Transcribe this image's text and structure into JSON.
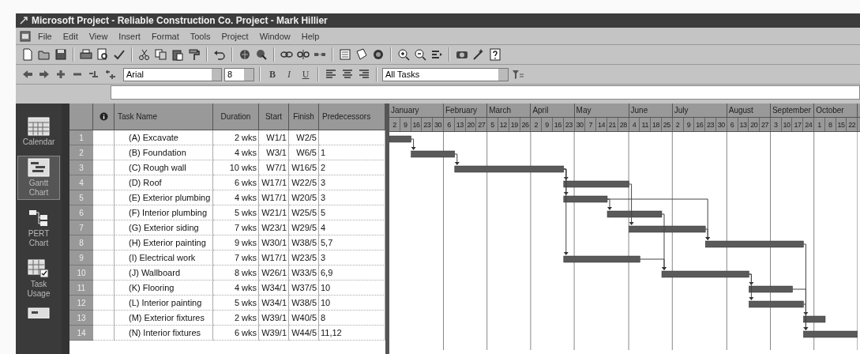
{
  "window": {
    "title": "Microsoft Project - Reliable Construction Co. Project - Mark Hillier"
  },
  "menu": [
    "File",
    "Edit",
    "View",
    "Insert",
    "Format",
    "Tools",
    "Project",
    "Window",
    "Help"
  ],
  "format_toolbar": {
    "font": "Arial",
    "font_size": "8",
    "style_buttons": [
      "B",
      "I",
      "U"
    ],
    "filter": "All Tasks"
  },
  "view_bar": [
    {
      "label": "Calendar",
      "selected": false,
      "kind": "calendar"
    },
    {
      "label": "Gantt Chart",
      "selected": true,
      "kind": "gantt"
    },
    {
      "label": "PERT Chart",
      "selected": false,
      "kind": "pert"
    },
    {
      "label": "Task Usage",
      "selected": false,
      "kind": "usage"
    }
  ],
  "table": {
    "columns": [
      "Task Name",
      "Duration",
      "Start",
      "Finish",
      "Predecessors"
    ],
    "rows": [
      {
        "id": "1",
        "name": "(A) Excavate",
        "duration": "2 wks",
        "start": "W1/1",
        "finish": "W2/5"
      },
      {
        "id": "2",
        "name": "(B) Foundation",
        "duration": "4 wks",
        "start": "W3/1",
        "finish": "W6/5",
        "predecessors": "1"
      },
      {
        "id": "3",
        "name": "(C) Rough wall",
        "duration": "10 wks",
        "start": "W7/1",
        "finish": "W16/5",
        "predecessors": "2"
      },
      {
        "id": "4",
        "name": "(D) Roof",
        "duration": "6 wks",
        "start": "W17/1",
        "finish": "W22/5",
        "predecessors": "3"
      },
      {
        "id": "5",
        "name": "(E) Exterior plumbing",
        "duration": "4 wks",
        "start": "W17/1",
        "finish": "W20/5",
        "predecessors": "3"
      },
      {
        "id": "6",
        "name": "(F) Interior plumbing",
        "duration": "5 wks",
        "start": "W21/1",
        "finish": "W25/5",
        "predecessors": "5"
      },
      {
        "id": "7",
        "name": "(G) Exterior siding",
        "duration": "7 wks",
        "start": "W23/1",
        "finish": "W29/5",
        "predecessors": "4"
      },
      {
        "id": "8",
        "name": "(H) Exterior painting",
        "duration": "9 wks",
        "start": "W30/1",
        "finish": "W38/5",
        "predecessors": "5,7"
      },
      {
        "id": "9",
        "name": "(I) Electrical work",
        "duration": "7 wks",
        "start": "W17/1",
        "finish": "W23/5",
        "predecessors": "3"
      },
      {
        "id": "10",
        "name": "(J) Wallboard",
        "duration": "8 wks",
        "start": "W26/1",
        "finish": "W33/5",
        "predecessors": "6,9"
      },
      {
        "id": "11",
        "name": "(K) Flooring",
        "duration": "4 wks",
        "start": "W34/1",
        "finish": "W37/5",
        "predecessors": "10"
      },
      {
        "id": "12",
        "name": "(L) Interior painting",
        "duration": "5 wks",
        "start": "W34/1",
        "finish": "W38/5",
        "predecessors": "10"
      },
      {
        "id": "13",
        "name": "(M) Exterior fixtures",
        "duration": "2 wks",
        "start": "W39/1",
        "finish": "W40/5",
        "predecessors": "8"
      },
      {
        "id": "14",
        "name": "(N) Interior fixtures",
        "duration": "6 wks",
        "start": "W39/1",
        "finish": "W44/5",
        "predecessors": "11,12"
      }
    ]
  },
  "timescale": {
    "months": [
      {
        "label": "January",
        "weeks": [
          "2",
          "9",
          "16",
          "23",
          "30"
        ]
      },
      {
        "label": "February",
        "weeks": [
          "6",
          "13",
          "20",
          "27"
        ]
      },
      {
        "label": "March",
        "weeks": [
          "5",
          "12",
          "19",
          "26"
        ]
      },
      {
        "label": "April",
        "weeks": [
          "2",
          "9",
          "16",
          "23"
        ]
      },
      {
        "label": "May",
        "weeks": [
          "30",
          "7",
          "14",
          "21",
          "28"
        ]
      },
      {
        "label": "June",
        "weeks": [
          "4",
          "11",
          "18",
          "25"
        ]
      },
      {
        "label": "July",
        "weeks": [
          "2",
          "9",
          "16",
          "23",
          "30"
        ]
      },
      {
        "label": "August",
        "weeks": [
          "6",
          "13",
          "20",
          "27"
        ]
      },
      {
        "label": "September",
        "weeks": [
          "3",
          "10",
          "17",
          "24"
        ]
      },
      {
        "label": "October",
        "weeks": [
          "1",
          "8",
          "15",
          "22"
        ]
      }
    ]
  }
}
